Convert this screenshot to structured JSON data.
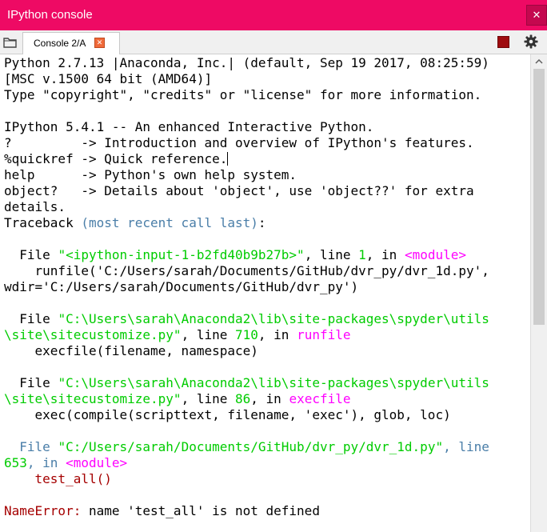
{
  "window": {
    "title": "IPython console",
    "close_glyph": "✕"
  },
  "tabbar": {
    "tab_label": "Console 2/A",
    "tab_close_glyph": "✕",
    "icons": [
      "folder-icon",
      "stop-icon",
      "gear-icon"
    ]
  },
  "colors": {
    "titlebar": "#ee0a64",
    "path": "#00cc00",
    "function": "#ff00ff",
    "keyword": "#4a7ea8",
    "error": "#a50000",
    "stop": "#9e0b0f"
  },
  "console": {
    "lines": [
      {
        "type": "banner",
        "text": "Python 2.7.13 |Anaconda, Inc.| (default, Sep 19 2017, 08:25:59)"
      },
      {
        "type": "banner",
        "text": "[MSC v.1500 64 bit (AMD64)]"
      },
      {
        "type": "banner",
        "text": "Type \"copyright\", \"credits\" or \"license\" for more information."
      },
      {
        "type": "blank",
        "text": ""
      },
      {
        "type": "banner",
        "text": "IPython 5.4.1 -- An enhanced Interactive Python."
      },
      {
        "type": "banner",
        "text": "?         -> Introduction and overview of IPython's features."
      },
      {
        "type": "banner",
        "text": "%quickref -> Quick reference."
      },
      {
        "type": "banner",
        "text": "help      -> Python's own help system."
      },
      {
        "type": "banner",
        "text": "object?   -> Details about 'object', use 'object??' for extra"
      },
      {
        "type": "banner",
        "text": "details."
      },
      {
        "type": "traceback_header",
        "text": "Traceback",
        "rest": "(most recent call last):"
      },
      {
        "type": "blank",
        "text": ""
      },
      {
        "type": "frame",
        "text": "  File \"<ipython-input-1-b2fd40b9b27b>\", line 1, in <module>"
      },
      {
        "type": "code",
        "text": "    runfile('C:/Users/sarah/Documents/GitHub/dvr_py/dvr_1d.py',"
      },
      {
        "type": "code",
        "text": "wdir='C:/Users/sarah/Documents/GitHub/dvr_py')"
      },
      {
        "type": "blank",
        "text": ""
      },
      {
        "type": "frame",
        "text": "  File \"C:\\Users\\sarah\\Anaconda2\\lib\\site-packages\\spyder\\utils"
      },
      {
        "type": "frame",
        "text": "\\site\\sitecustomize.py\", line 710, in runfile"
      },
      {
        "type": "code",
        "text": "    execfile(filename, namespace)"
      },
      {
        "type": "blank",
        "text": ""
      },
      {
        "type": "frame",
        "text": "  File \"C:\\Users\\sarah\\Anaconda2\\lib\\site-packages\\spyder\\utils"
      },
      {
        "type": "frame",
        "text": "\\site\\sitecustomize.py\", line 86, in execfile"
      },
      {
        "type": "code",
        "text": "    exec(compile(scripttext, filename, 'exec'), glob, loc)"
      },
      {
        "type": "blank",
        "text": ""
      },
      {
        "type": "frame",
        "text": "  File \"C:/Users/sarah/Documents/GitHub/dvr_py/dvr_1d.py\", line"
      },
      {
        "type": "frame",
        "text": "653, in <module>"
      },
      {
        "type": "error_code",
        "text": "    test_all()"
      },
      {
        "type": "blank",
        "text": ""
      },
      {
        "type": "error",
        "text": "NameError:",
        "rest": " name 'test_all' is not defined"
      }
    ],
    "segments": [
      [
        {
          "t": "Python 2.7.13 |Anaconda, Inc.| (default, Sep 19 2017, 08:25:59)"
        }
      ],
      [
        {
          "t": "[MSC v.1500 64 bit (AMD64)]"
        }
      ],
      [
        {
          "t": "Type \"copyright\", \"credits\" or \"license\" for more information."
        }
      ],
      [
        {
          "t": ""
        }
      ],
      [
        {
          "t": "IPython 5.4.1 -- An enhanced Interactive Python."
        }
      ],
      [
        {
          "t": "?         -> Introduction and overview of IPython's features."
        }
      ],
      [
        {
          "t": "%quickref -> Quick reference."
        },
        {
          "t": "",
          "c": "cursor"
        }
      ],
      [
        {
          "t": "help      -> Python's own help system."
        }
      ],
      [
        {
          "t": "object?   -> Details about 'object', use 'object??' for extra"
        }
      ],
      [
        {
          "t": "details."
        }
      ],
      [
        {
          "t": "Traceback "
        },
        {
          "t": "(most recent call last)",
          "c": "blue"
        },
        {
          "t": ":"
        }
      ],
      [
        {
          "t": ""
        }
      ],
      [
        {
          "t": "  File "
        },
        {
          "t": "\"<ipython-input-1-b2fd40b9b27b>\"",
          "c": "green"
        },
        {
          "t": ", line "
        },
        {
          "t": "1",
          "c": "green"
        },
        {
          "t": ", in "
        },
        {
          "t": "<module>",
          "c": "magenta"
        }
      ],
      [
        {
          "t": "    runfile('C:/Users/sarah/Documents/GitHub/dvr_py/dvr_1d.py',"
        }
      ],
      [
        {
          "t": "wdir='C:/Users/sarah/Documents/GitHub/dvr_py')"
        }
      ],
      [
        {
          "t": ""
        }
      ],
      [
        {
          "t": "  File "
        },
        {
          "t": "\"C:\\Users\\sarah\\Anaconda2\\lib\\site-packages\\spyder\\utils",
          "c": "green"
        }
      ],
      [
        {
          "t": "\\site\\sitecustomize.py\"",
          "c": "green"
        },
        {
          "t": ", line "
        },
        {
          "t": "710",
          "c": "green"
        },
        {
          "t": ", in "
        },
        {
          "t": "runfile",
          "c": "magenta"
        }
      ],
      [
        {
          "t": "    execfile(filename, namespace)"
        }
      ],
      [
        {
          "t": ""
        }
      ],
      [
        {
          "t": "  File "
        },
        {
          "t": "\"C:\\Users\\sarah\\Anaconda2\\lib\\site-packages\\spyder\\utils",
          "c": "green"
        }
      ],
      [
        {
          "t": "\\site\\sitecustomize.py\"",
          "c": "green"
        },
        {
          "t": ", line "
        },
        {
          "t": "86",
          "c": "green"
        },
        {
          "t": ", in "
        },
        {
          "t": "execfile",
          "c": "magenta"
        }
      ],
      [
        {
          "t": "    exec(compile(scripttext, filename, 'exec'), glob, loc)"
        }
      ],
      [
        {
          "t": ""
        }
      ],
      [
        {
          "t": "  File ",
          "c": "blue"
        },
        {
          "t": "\"C:/Users/sarah/Documents/GitHub/dvr_py/dvr_1d.py\"",
          "c": "green"
        },
        {
          "t": ", line",
          "c": "blue"
        }
      ],
      [
        {
          "t": "653",
          "c": "green"
        },
        {
          "t": ", in ",
          "c": "blue"
        },
        {
          "t": "<module>",
          "c": "magenta"
        }
      ],
      [
        {
          "t": "    test_all()",
          "c": "red"
        }
      ],
      [
        {
          "t": ""
        }
      ],
      [
        {
          "t": "NameError:",
          "c": "red"
        },
        {
          "t": " name 'test_all' is not defined"
        }
      ]
    ]
  }
}
